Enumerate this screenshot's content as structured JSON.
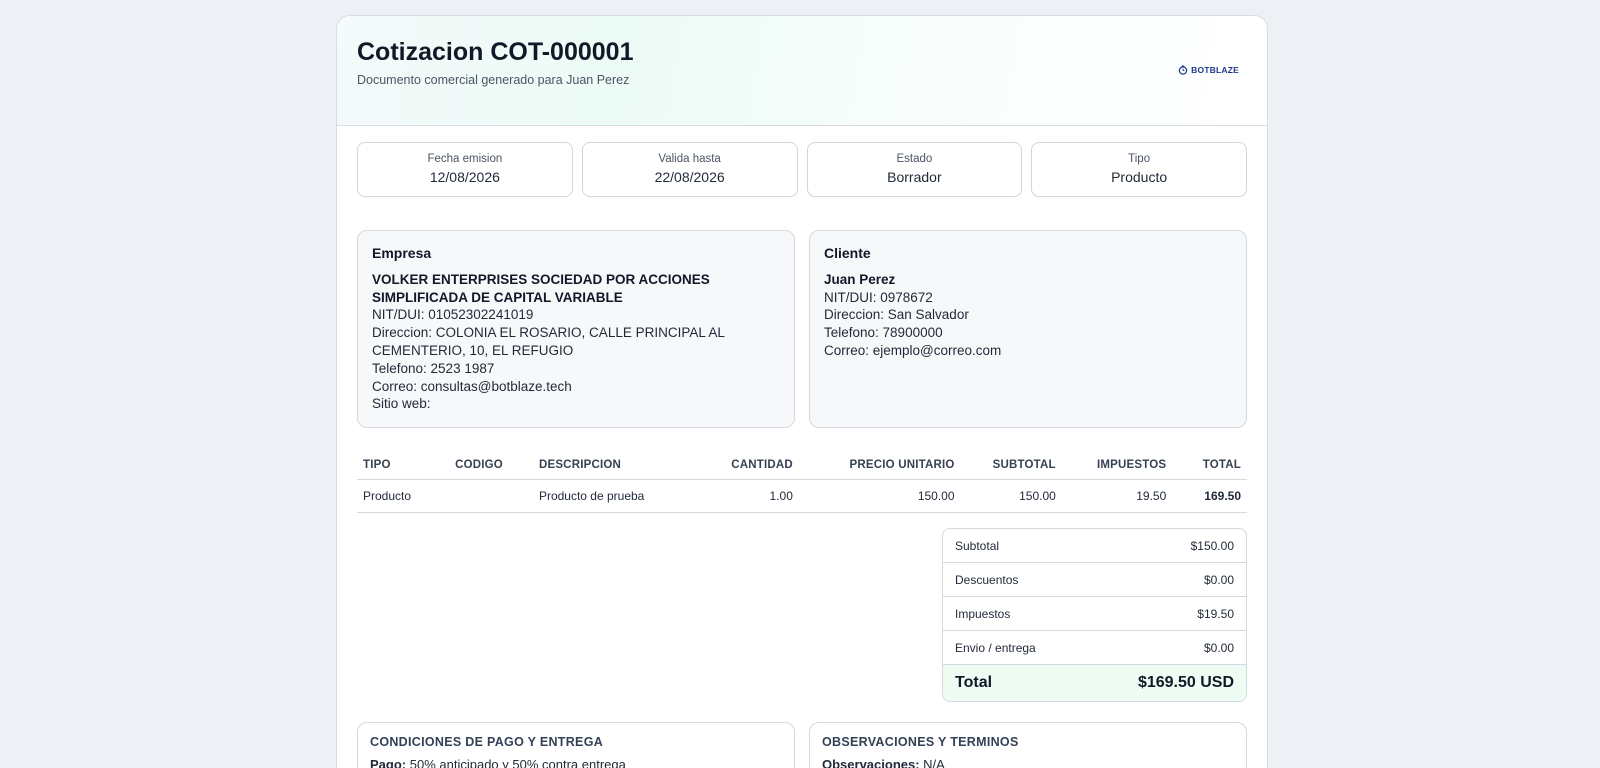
{
  "header": {
    "title": "Cotizacion COT-000001",
    "subtitle": "Documento comercial generado para Juan Perez",
    "logo_text": "BOTBLAZE",
    "logo_color": "#1e3a8a"
  },
  "meta": [
    {
      "label": "Fecha emision",
      "value": "12/08/2026"
    },
    {
      "label": "Valida hasta",
      "value": "22/08/2026"
    },
    {
      "label": "Estado",
      "value": "Borrador"
    },
    {
      "label": "Tipo",
      "value": "Producto"
    }
  ],
  "empresa": {
    "heading": "Empresa",
    "name": "VOLKER ENTERPRISES SOCIEDAD POR ACCIONES SIMPLIFICADA DE CAPITAL VARIABLE",
    "nit": "NIT/DUI: 01052302241019",
    "direccion": "Direccion: COLONIA EL ROSARIO, CALLE PRINCIPAL AL CEMENTERIO, 10, EL REFUGIO",
    "telefono": "Telefono: 2523 1987",
    "correo": "Correo: consultas@botblaze.tech",
    "sitio": "Sitio web:"
  },
  "cliente": {
    "heading": "Cliente",
    "name": "Juan Perez",
    "nit": "NIT/DUI: 0978672",
    "direccion": "Direccion: San Salvador",
    "telefono": "Telefono: 78900000",
    "correo": "Correo: ejemplo@correo.com"
  },
  "table": {
    "headers": [
      "TIPO",
      "CODIGO",
      "DESCRIPCION",
      "CANTIDAD",
      "PRECIO UNITARIO",
      "SUBTOTAL",
      "IMPUESTOS",
      "TOTAL"
    ],
    "rows": [
      [
        "Producto",
        "",
        "Producto de prueba",
        "1.00",
        "150.00",
        "150.00",
        "19.50",
        "169.50"
      ]
    ]
  },
  "totals": {
    "subtotal_label": "Subtotal",
    "subtotal": "$150.00",
    "descuentos_label": "Descuentos",
    "descuentos": "$0.00",
    "impuestos_label": "Impuestos",
    "impuestos": "$19.50",
    "envio_label": "Envio / entrega",
    "envio": "$0.00",
    "total_label": "Total",
    "total": "$169.50 USD"
  },
  "condiciones": {
    "heading": "CONDICIONES DE PAGO Y ENTREGA",
    "pago_label": "Pago:",
    "pago_text": "50% anticipado y 50% contra entrega"
  },
  "observaciones": {
    "heading": "OBSERVACIONES Y TERMINOS",
    "obs_label": "Observaciones:",
    "obs_text": "N/A"
  }
}
